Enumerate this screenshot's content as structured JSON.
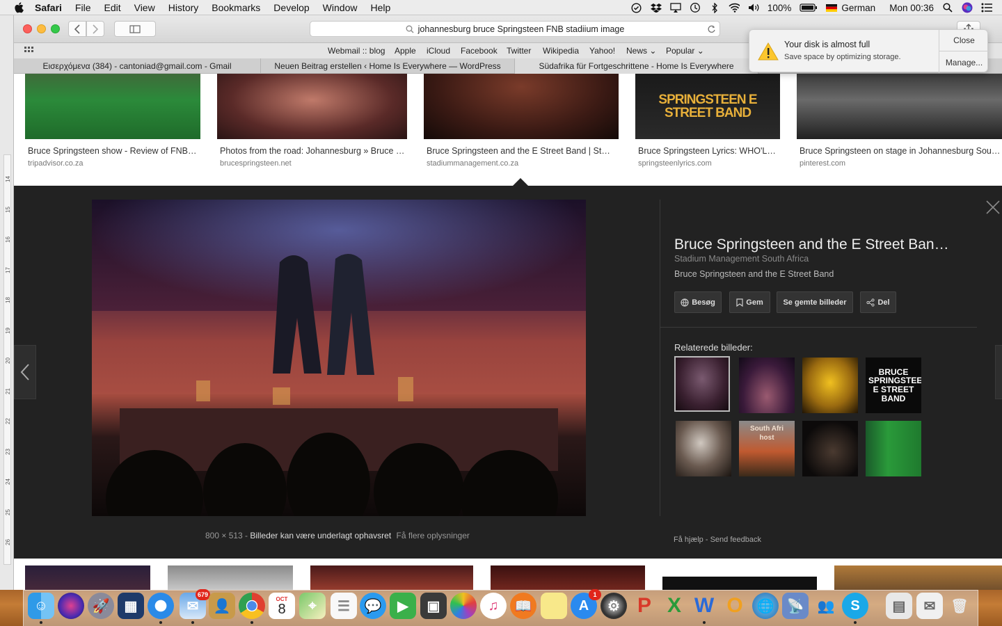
{
  "menubar": {
    "app": "Safari",
    "items": [
      "File",
      "Edit",
      "View",
      "History",
      "Bookmarks",
      "Develop",
      "Window",
      "Help"
    ],
    "battery": "100%",
    "input_source": "German",
    "clock": "Mon 00:36"
  },
  "toolbar": {
    "url": "johannesburg bruce Springsteen FNB stadiium image"
  },
  "favorites": [
    "Webmail :: blog",
    "Apple",
    "iCloud",
    "Facebook",
    "Twitter",
    "Wikipedia",
    "Yahoo!",
    "News",
    "Popular"
  ],
  "tabs": [
    "Εισερχόμενα (384) - cantoniad@gmail.com - Gmail",
    "Neuen Beitrag erstellen ‹ Home Is Everywhere — WordPress",
    "Südafrika für Fortgeschrittene - Home Is Everywhere"
  ],
  "ruler_ticks": [
    "14",
    "15",
    "16",
    "17",
    "18",
    "19",
    "20",
    "21",
    "22",
    "23",
    "24",
    "25",
    "26"
  ],
  "results_top": [
    {
      "title": "Bruce Springsteen show - Review of FNB…",
      "domain": "tripadvisor.co.za"
    },
    {
      "title": "Photos from the road: Johannesburg » Bruce …",
      "domain": "brucespringsteen.net"
    },
    {
      "title": "Bruce Springsteen and the E Street Band | Sta…",
      "domain": "stadiummanagement.co.za"
    },
    {
      "title": "Bruce Springsteen Lyrics: WHO'L…",
      "domain": "springsteenlyrics.com",
      "image_text": "SPRINGSTEEN E STREET BAND"
    },
    {
      "title": "Bruce Springsteen on stage in Johannesburg Sout…",
      "domain": "pinterest.com"
    }
  ],
  "preview": {
    "size": "800 × 513",
    "copyright": "Billeder kan være underlagt ophavsret",
    "more_info": "Få flere oplysninger",
    "title": "Bruce Springsteen and the E Street Ban…",
    "site": "Stadium Management South Africa",
    "subtitle": "Bruce Springsteen and the E Street Band",
    "buttons": {
      "visit": "Besøg",
      "save": "Gem",
      "saved": "Se gemte billeder",
      "share": "Del"
    },
    "related_label": "Relaterede billeder:",
    "related_texts": {
      "logo": "BRUCE SPRINGSTEEN E STREET BAND",
      "stadium": "South Afri host"
    },
    "help": "Få hjælp",
    "feedback": "Send feedback"
  },
  "notification": {
    "title": "Your disk is almost full",
    "body": "Save space by optimizing storage.",
    "close": "Close",
    "manage": "Manage..."
  },
  "dock": {
    "mail_badge": "679",
    "calendar_month": "OCT",
    "calendar_day": "8",
    "appstore_badge": "1"
  }
}
